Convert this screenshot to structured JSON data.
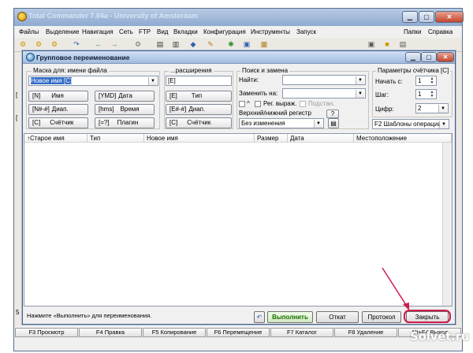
{
  "main_window": {
    "title": "Total Commander 7.04a - University of Amsterdam",
    "menu_left": [
      "Файлы",
      "Выделение",
      "Навигация",
      "Сеть",
      "FTP",
      "Вид",
      "Вкладки",
      "Конфигурация",
      "Инструменты",
      "Запуск"
    ],
    "menu_right": [
      "Папки",
      "Справка"
    ]
  },
  "dialog": {
    "title": "Групповое переименование",
    "mask": {
      "label": "Маска для: имени файла",
      "value": "Новое имя [C]",
      "buttons": [
        {
          "key": "[N]",
          "label": "Имя"
        },
        {
          "key": "[YMD]",
          "label": "Дата"
        },
        {
          "key": "[N#-#]",
          "label": "Диап."
        },
        {
          "key": "[hms]",
          "label": "Время"
        },
        {
          "key": "[C]",
          "label": "Счётчик"
        },
        {
          "key": "[=?]",
          "label": "Плагин"
        }
      ]
    },
    "ext": {
      "label": "...расширения",
      "value": "[E]",
      "buttons": [
        {
          "key": "[E]",
          "label": "Тип"
        },
        {
          "key": "[E#-#]",
          "label": "Диап."
        },
        {
          "key": "[C]",
          "label": "Счётчик"
        }
      ]
    },
    "search": {
      "label": "Поиск и замена",
      "find_label": "Найти:",
      "find_value": "",
      "replace_label": "Заменить на:",
      "replace_value": "",
      "regex_label": "Рег. выраж.",
      "subst_label": "Подстан.",
      "case_label": "Верхний/нижний регистр",
      "case_help": "?",
      "case_value": "Без изменения"
    },
    "counter": {
      "label": "Параметры счётчика [C]",
      "start_label": "Начать с:",
      "start_value": "1",
      "step_label": "Шаг:",
      "step_value": "1",
      "digits_label": "Цифр:",
      "digits_value": "2",
      "templates_value": "F2 Шаблоны операции"
    },
    "table": {
      "columns": [
        "Старое имя",
        "Тип",
        "Новое имя",
        "Размер",
        "Дата",
        "Местоположение"
      ],
      "rows": []
    },
    "status_text": "Нажмите «Выполнить» для переименования.",
    "buttons": {
      "execute": "Выполнить",
      "undo": "Откат",
      "log": "Протокол",
      "close": "Закрыть"
    }
  },
  "fkeys": [
    "F3 Просмотр",
    "F4 Правка",
    "F5 Копирование",
    "F6 Перемещение",
    "F7 Каталог",
    "F8 Удаление",
    "Alt+F4 Выход"
  ],
  "watermark": "Solvet.ru",
  "colors": {
    "highlight": "#d21a4b",
    "execute_text": "#1b6e00",
    "selection": "#316ac5"
  }
}
